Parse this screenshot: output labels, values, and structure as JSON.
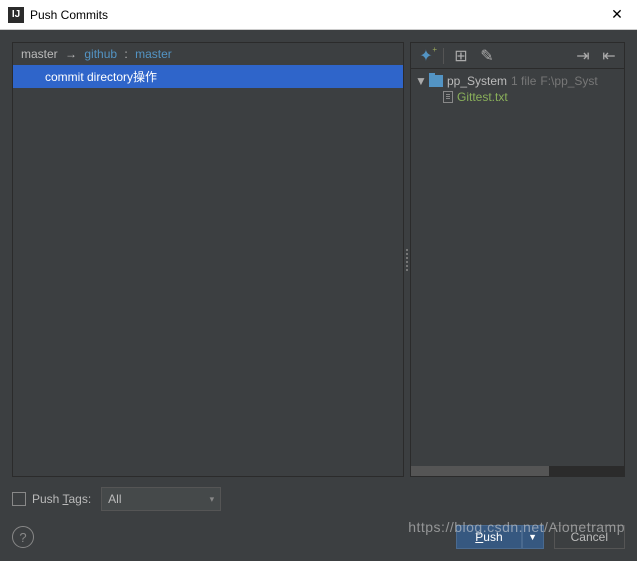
{
  "window": {
    "title": "Push Commits",
    "icon_letter": "IJ"
  },
  "branch": {
    "local": "master",
    "arrow": "→",
    "remote": "github",
    "colon": ":",
    "remote_branch": "master"
  },
  "commit": {
    "message": "commit directory操作"
  },
  "toolbar_icons": {
    "diff_star": "✦",
    "layout": "⊞",
    "edit": "✎",
    "expand": "⇥",
    "collapse": "⇤"
  },
  "tree": {
    "root": {
      "twisty": "▼",
      "name": "pp_System",
      "count": "1 file",
      "path": "F:\\pp_Syst"
    },
    "file": {
      "name": "Gittest.txt"
    }
  },
  "push_tags": {
    "label_pre": "Push ",
    "label_ul": "T",
    "label_post": "ags:",
    "value": "All",
    "chev": "▾"
  },
  "buttons": {
    "help": "?",
    "push_ul": "P",
    "push_rest": "ush",
    "drop": "▼",
    "cancel": "Cancel"
  },
  "watermark": "https://blog.csdn.net/Alonetramp"
}
